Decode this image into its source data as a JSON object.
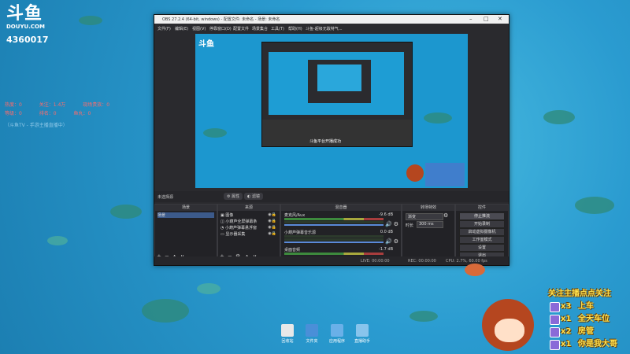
{
  "stream": {
    "logo_text": "斗鱼",
    "logo_sub": "DOUYU.COM",
    "room_id": "4360017",
    "stats": {
      "row1": [
        "热度：0",
        "关注：1.4万",
        "现场贵族：0"
      ],
      "row2": [
        "等级：0",
        "排名：0",
        "鱼丸：0"
      ]
    },
    "tip": "（斗鱼TV - 手游主播直播中）"
  },
  "obs": {
    "title": "OBS 27.2.4 (64-bit, windows) - 配置文件: 未命名 - 场景: 未命名",
    "menu": [
      "文件(F)",
      "编辑(E)",
      "视图(V)",
      "停靠窗口(D)",
      "配置文件",
      "场景集合",
      "工具(T)",
      "帮助(H)",
      "斗鱼-超级无敌特气..."
    ],
    "scene_bar_label": "未选择源",
    "scene_bar_buttons": [
      "属性",
      "滤镜"
    ],
    "toast": "斗鱼平台开播成功",
    "docks": {
      "scenes": {
        "title": "场景",
        "items": [
          "场景"
        ]
      },
      "sources": {
        "title": "来源",
        "items": [
          "图像",
          "小葫芦全屏弹幕条",
          "小葫芦弹幕悬浮窗",
          "显示器采集"
        ]
      },
      "mixer": {
        "title": "混音器",
        "channels": [
          {
            "name": "麦克风/Aux",
            "db": "-9.6 dB"
          },
          {
            "name": "小葫芦弹幕音乐源",
            "db": "0.0 dB"
          },
          {
            "name": "桌面音频",
            "db": "-1.7 dB"
          }
        ]
      },
      "transitions": {
        "title": "转场特效",
        "type": "渐变",
        "duration_label": "时长",
        "duration": "300 ms"
      },
      "controls": {
        "title": "控件",
        "buttons": [
          "停止推流",
          "开始录制",
          "启动虚拟摄像机",
          "工作室模式",
          "设置",
          "退出"
        ]
      }
    },
    "status": {
      "live": "LIVE: 00:00:00",
      "rec": "REC: 00:00:00",
      "cpu": "CPU: 2.7%, 60.00 fps"
    }
  },
  "desktop_icons": [
    "回收站",
    "文件夹",
    "应用程序",
    "直播助手"
  ],
  "follow_panel": {
    "title": "关注主播点点关注",
    "rewards": [
      {
        "count": "x3",
        "text": "上车"
      },
      {
        "count": "x1",
        "text": "全天车位"
      },
      {
        "count": "x2",
        "text": "房管"
      },
      {
        "count": "x1",
        "text": "你是我大哥"
      }
    ]
  }
}
